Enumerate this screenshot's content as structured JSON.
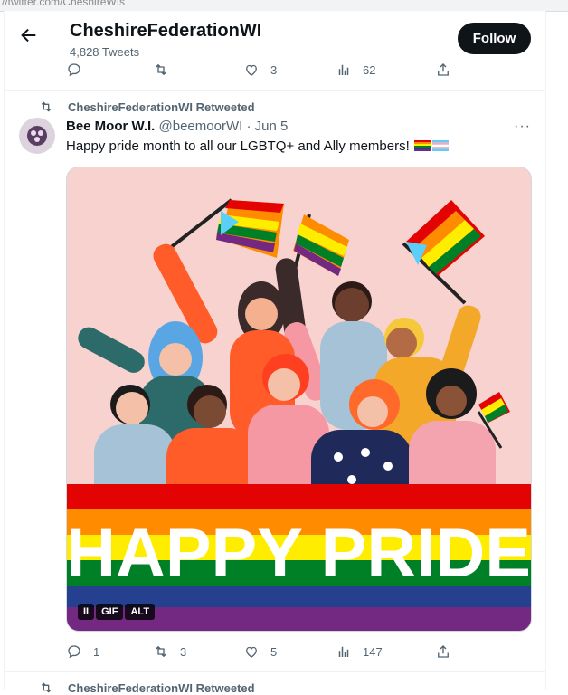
{
  "browser": {
    "url_fragment": "//twitter.com/CheshireWIs"
  },
  "header": {
    "title": "CheshireFederationWI",
    "subtitle": "4,828 Tweets",
    "follow_label": "Follow"
  },
  "prev_actions": {
    "reply": "",
    "retweet": "",
    "like": "3",
    "views": "62"
  },
  "retweet_banner": {
    "text": "CheshireFederationWI Retweeted"
  },
  "tweet": {
    "author_name": "Bee Moor W.I.",
    "handle": "@beemoorWI",
    "separator": "·",
    "date": "Jun 5",
    "more": "···",
    "text": "Happy pride month to all our LGBTQ+ and Ally members!",
    "media": {
      "banner_text": "HAPPY PRIDE",
      "pause": "II",
      "gif": "GIF",
      "alt": "ALT"
    },
    "actions": {
      "reply": "1",
      "retweet": "3",
      "like": "5",
      "views": "147"
    }
  },
  "next_retweet_banner": {
    "text": "CheshireFederationWI Retweeted"
  },
  "colors": {
    "accent": "#0f1419",
    "muted": "#536471",
    "border": "#eff3f4",
    "media_bg": "#f7d2cf"
  }
}
